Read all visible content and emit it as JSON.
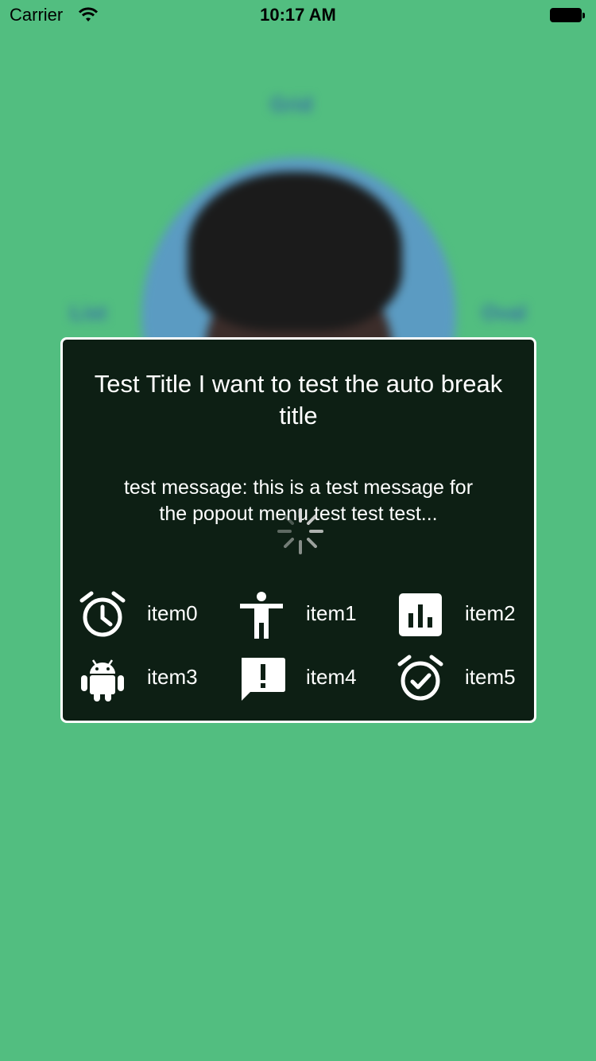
{
  "status_bar": {
    "carrier": "Carrier",
    "time": "10:17 AM"
  },
  "background": {
    "labels": {
      "top": "Grid",
      "left": "List",
      "right": "Oval"
    },
    "accent_color": "#52be80"
  },
  "popout": {
    "title": "Test Title I want to test the auto break title",
    "message": "test message: this is a test message for the popout menu test test test...",
    "items": [
      {
        "label": "item0",
        "icon": "alarm-clock-icon"
      },
      {
        "label": "item1",
        "icon": "accessibility-icon"
      },
      {
        "label": "item2",
        "icon": "bar-chart-icon"
      },
      {
        "label": "item3",
        "icon": "android-icon"
      },
      {
        "label": "item4",
        "icon": "feedback-icon"
      },
      {
        "label": "item5",
        "icon": "alarm-check-icon"
      }
    ]
  }
}
